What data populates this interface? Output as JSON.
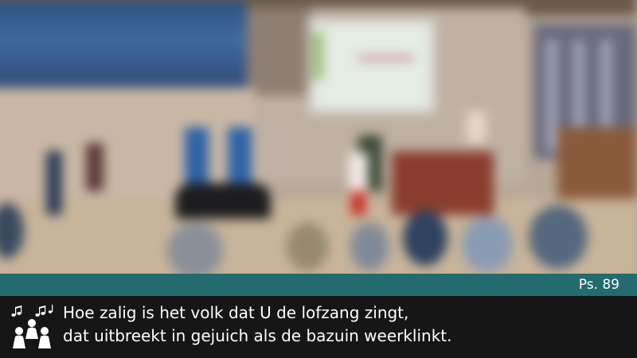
{
  "reference": {
    "text": "Ps. 89"
  },
  "lyrics": {
    "lines": [
      "Hoe zalig is het volk dat U de lofzang zingt,",
      "dat uitbreekt in gejuich als de bazuin weerklinkt."
    ]
  },
  "icons": {
    "singers": "singers-icon"
  },
  "colors": {
    "reference_bar": "#236b6f",
    "lyrics_background": "#161616",
    "text": "#ffffff"
  }
}
